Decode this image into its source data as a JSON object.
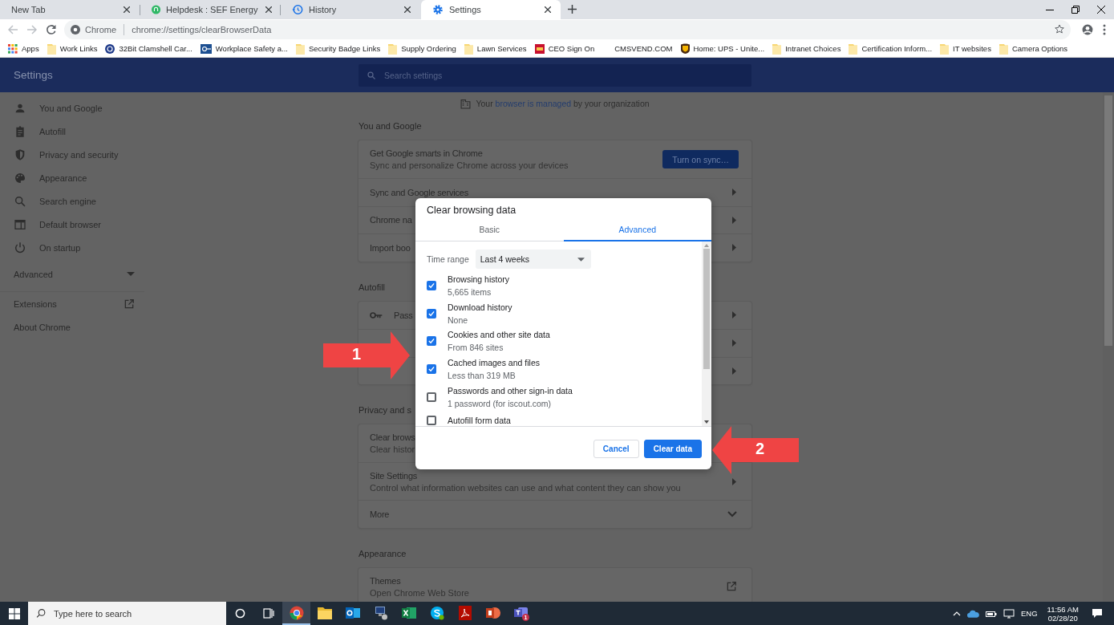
{
  "browser": {
    "tabs": [
      {
        "title": "New Tab",
        "selected": false
      },
      {
        "title": "Helpdesk : SEF Energy",
        "selected": false
      },
      {
        "title": "History",
        "selected": false
      },
      {
        "title": "Settings",
        "selected": true
      }
    ],
    "omnibox": {
      "site_label": "Chrome",
      "url": "chrome://settings/clearBrowserData"
    },
    "bookmarks": [
      "Apps",
      "Work Links",
      "32Bit Clamshell Car...",
      "Workplace Safety a...",
      "Security Badge Links",
      "Supply Ordering",
      "Lawn Services",
      "CEO Sign On",
      "CMSVEND.COM",
      "Home: UPS - Unite...",
      "Intranet Choices",
      "Certification Inform...",
      "IT websites",
      "Camera Options"
    ]
  },
  "settings": {
    "title": "Settings",
    "search": {
      "placeholder": "Search settings"
    },
    "sidebar": {
      "items": [
        "You and Google",
        "Autofill",
        "Privacy and security",
        "Appearance",
        "Search engine",
        "Default browser",
        "On startup"
      ],
      "advanced": {
        "label": "Advanced",
        "expanded": false
      },
      "links": [
        "Extensions",
        "About Chrome"
      ]
    },
    "managed_notice": {
      "before": "Your",
      "link": "browser is managed",
      "after": "by your organization"
    },
    "sections": [
      {
        "heading": "You and Google",
        "rows": [
          {
            "title": "Get Google smarts in Chrome",
            "subtitle": "Sync and personalize Chrome across your devices",
            "button": "Turn on sync…"
          },
          {
            "title": "Sync and Google services"
          },
          {
            "title": "Chrome na"
          },
          {
            "title": "Import boo"
          }
        ]
      },
      {
        "heading": "Autofill",
        "rows": [
          {
            "title": "Pass"
          },
          {},
          {}
        ]
      },
      {
        "heading": "Privacy and s",
        "rows": [
          {
            "title": "Clear brows",
            "subtitle": "Clear histor"
          },
          {
            "title": "Site Settings",
            "subtitle": "Control what information websites can use and what content they can show you"
          },
          {
            "title": "More"
          }
        ]
      },
      {
        "heading": "Appearance",
        "rows": [
          {
            "title": "Themes",
            "subtitle": "Open Chrome Web Store"
          }
        ]
      }
    ]
  },
  "dialog": {
    "title": "Clear browsing data",
    "tabs": [
      {
        "label": "Basic",
        "selected": false
      },
      {
        "label": "Advanced",
        "selected": true
      }
    ],
    "time_range": {
      "label": "Time range",
      "value": "Last 4 weeks"
    },
    "options": [
      {
        "title": "Browsing history",
        "subtitle": "5,665 items",
        "checked": true
      },
      {
        "title": "Download history",
        "subtitle": "None",
        "checked": true
      },
      {
        "title": "Cookies and other site data",
        "subtitle": "From 846 sites",
        "checked": true
      },
      {
        "title": "Cached images and files",
        "subtitle": "Less than 319 MB",
        "checked": true
      },
      {
        "title": "Passwords and other sign-in data",
        "subtitle": "1 password (for iscout.com)",
        "checked": false
      },
      {
        "title": "Autofill form data",
        "checked": false
      }
    ],
    "buttons": [
      "Cancel",
      "Clear data"
    ]
  },
  "annotations": [
    "1",
    "2"
  ],
  "taskbar": {
    "search": {
      "placeholder": "Type here to search"
    },
    "apps": [
      {
        "active": true
      },
      {
        "active": false
      },
      {
        "active": false
      },
      {
        "active": false
      },
      {
        "active": false
      },
      {
        "active": false
      },
      {
        "active": false
      },
      {
        "active": false
      },
      {
        "active": false,
        "badge": "1"
      }
    ],
    "tray": {
      "language": "ENG",
      "time": "11:56 AM",
      "date": "02/28/20"
    }
  }
}
